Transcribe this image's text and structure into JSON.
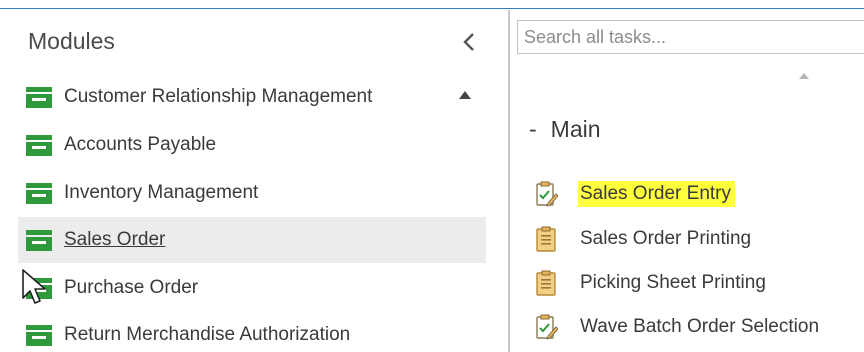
{
  "modules_panel": {
    "title": "Modules",
    "collapse_icon": "chevron-left-icon",
    "items": [
      {
        "label": "Customer Relationship Management",
        "icon": "module-folder-icon",
        "selected": false,
        "expand_icon": "triangle-up-icon"
      },
      {
        "label": "Accounts Payable",
        "icon": "module-folder-icon",
        "selected": false
      },
      {
        "label": "Inventory Management",
        "icon": "module-folder-icon",
        "selected": false
      },
      {
        "label": "Sales Order",
        "icon": "module-folder-icon",
        "selected": true
      },
      {
        "label": "Purchase Order",
        "icon": "module-folder-icon",
        "selected": false
      },
      {
        "label": "Return Merchandise Authorization",
        "icon": "module-folder-icon",
        "selected": false
      }
    ]
  },
  "tasks_panel": {
    "search": {
      "placeholder": "Search all tasks...",
      "value": ""
    },
    "scroll_up_icon": "scroll-up-arrow-icon",
    "group": {
      "collapse_symbol": "-",
      "title": "Main"
    },
    "tasks": [
      {
        "label": "Sales Order Entry",
        "icon": "clipboard-pencil-icon",
        "highlighted": true
      },
      {
        "label": "Sales Order Printing",
        "icon": "clipboard-icon",
        "highlighted": false
      },
      {
        "label": "Picking Sheet Printing",
        "icon": "clipboard-icon",
        "highlighted": false
      },
      {
        "label": "Wave Batch Order Selection",
        "icon": "clipboard-pencil-icon",
        "highlighted": false
      }
    ]
  },
  "colors": {
    "module_icon_green": "#2f9a3c",
    "highlight_yellow": "#ffff3c",
    "selected_row_bg": "#ececec",
    "clipboard_tan": "#e6b45a"
  }
}
